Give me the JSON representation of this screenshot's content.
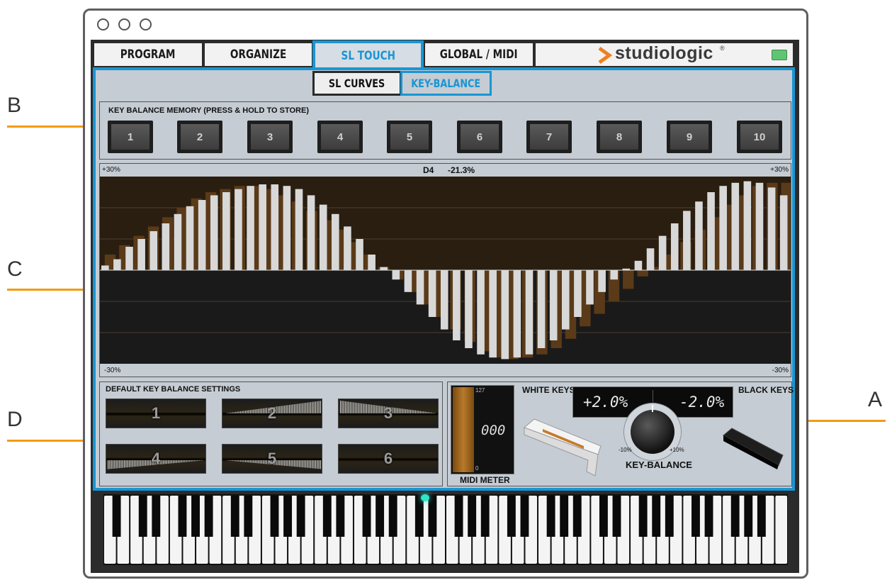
{
  "window": {
    "controls": [
      "close",
      "minimize",
      "zoom"
    ]
  },
  "tabs": [
    {
      "label": "PROGRAM",
      "active": false
    },
    {
      "label": "ORGANIZE",
      "active": false
    },
    {
      "label": "SL TOUCH",
      "active": true
    },
    {
      "label": "GLOBAL / MIDI",
      "active": false
    }
  ],
  "brand": {
    "name": "studiologic",
    "mark": "®",
    "arrow_color": "#f07f1e",
    "status_led": "green"
  },
  "subtabs": [
    {
      "label": "SL CURVES",
      "active": false
    },
    {
      "label": "KEY-BALANCE",
      "active": true
    }
  ],
  "memory": {
    "title": "KEY BALANCE MEMORY (PRESS & HOLD TO STORE)",
    "slots": [
      "1",
      "2",
      "3",
      "4",
      "5",
      "6",
      "7",
      "8",
      "9",
      "10"
    ]
  },
  "balance_chart": {
    "top_left": "+30%",
    "top_right": "+30%",
    "bottom_left": "-30%",
    "bottom_right": "-30%",
    "selected_note": "D4",
    "selected_value": "-21.3%"
  },
  "chart_data": {
    "type": "bar",
    "ylim": [
      -30,
      30
    ],
    "keys_count": 88,
    "description_values_percent": "per-key balance, sine-like curve",
    "white_keys": [
      1.5,
      3.5,
      7.5,
      10,
      12.5,
      15,
      18,
      20.5,
      22.5,
      24,
      25,
      26,
      27,
      27.5,
      27.5,
      27,
      26,
      24,
      21,
      18,
      14,
      10,
      5,
      1,
      -3,
      -7,
      -11,
      -15,
      -19,
      -22.5,
      -25,
      -27,
      -28,
      -28.5,
      -28,
      -27,
      -25,
      -22.5,
      -19,
      -15,
      -11,
      -7,
      -3,
      0.5,
      3,
      7,
      11,
      15,
      19,
      22,
      25,
      27,
      28,
      28.5,
      28,
      26.5,
      24
    ],
    "black_keys": [
      5,
      8,
      11,
      14,
      17,
      20,
      23,
      25,
      26,
      27,
      27,
      26,
      24,
      22,
      19,
      16,
      13,
      9,
      5,
      1,
      -3,
      -7,
      -11,
      -15,
      -19,
      -23,
      -26,
      -28,
      -28.5,
      -28,
      -27,
      -25,
      -22,
      -18,
      -14,
      -10,
      -6,
      -2,
      1,
      5,
      9,
      13,
      17,
      21,
      24,
      27,
      28,
      28
    ]
  },
  "defaults": {
    "title": "DEFAULT KEY BALANCE SETTINGS",
    "presets": [
      "1",
      "2",
      "3",
      "4",
      "5",
      "6"
    ]
  },
  "key_balance": {
    "white_keys_label": "WHITE KEYS",
    "black_keys_label": "BLACK KEYS",
    "white_value": "+2.0%",
    "black_value": "-2.0%",
    "knob_min": "-10%",
    "knob_max": "+10%",
    "knob_label": "KEY-BALANCE",
    "knob_value_percent": 2.0
  },
  "midi_meter": {
    "label": "MIDI METER",
    "max": "127",
    "min": "0",
    "value": "000",
    "fill_color": "#a86a1c"
  },
  "callouts": [
    "A",
    "B",
    "C",
    "D"
  ],
  "colors": {
    "accent": "#1a95d3",
    "callout": "#f29b12",
    "panel": "#c5ccd3"
  }
}
